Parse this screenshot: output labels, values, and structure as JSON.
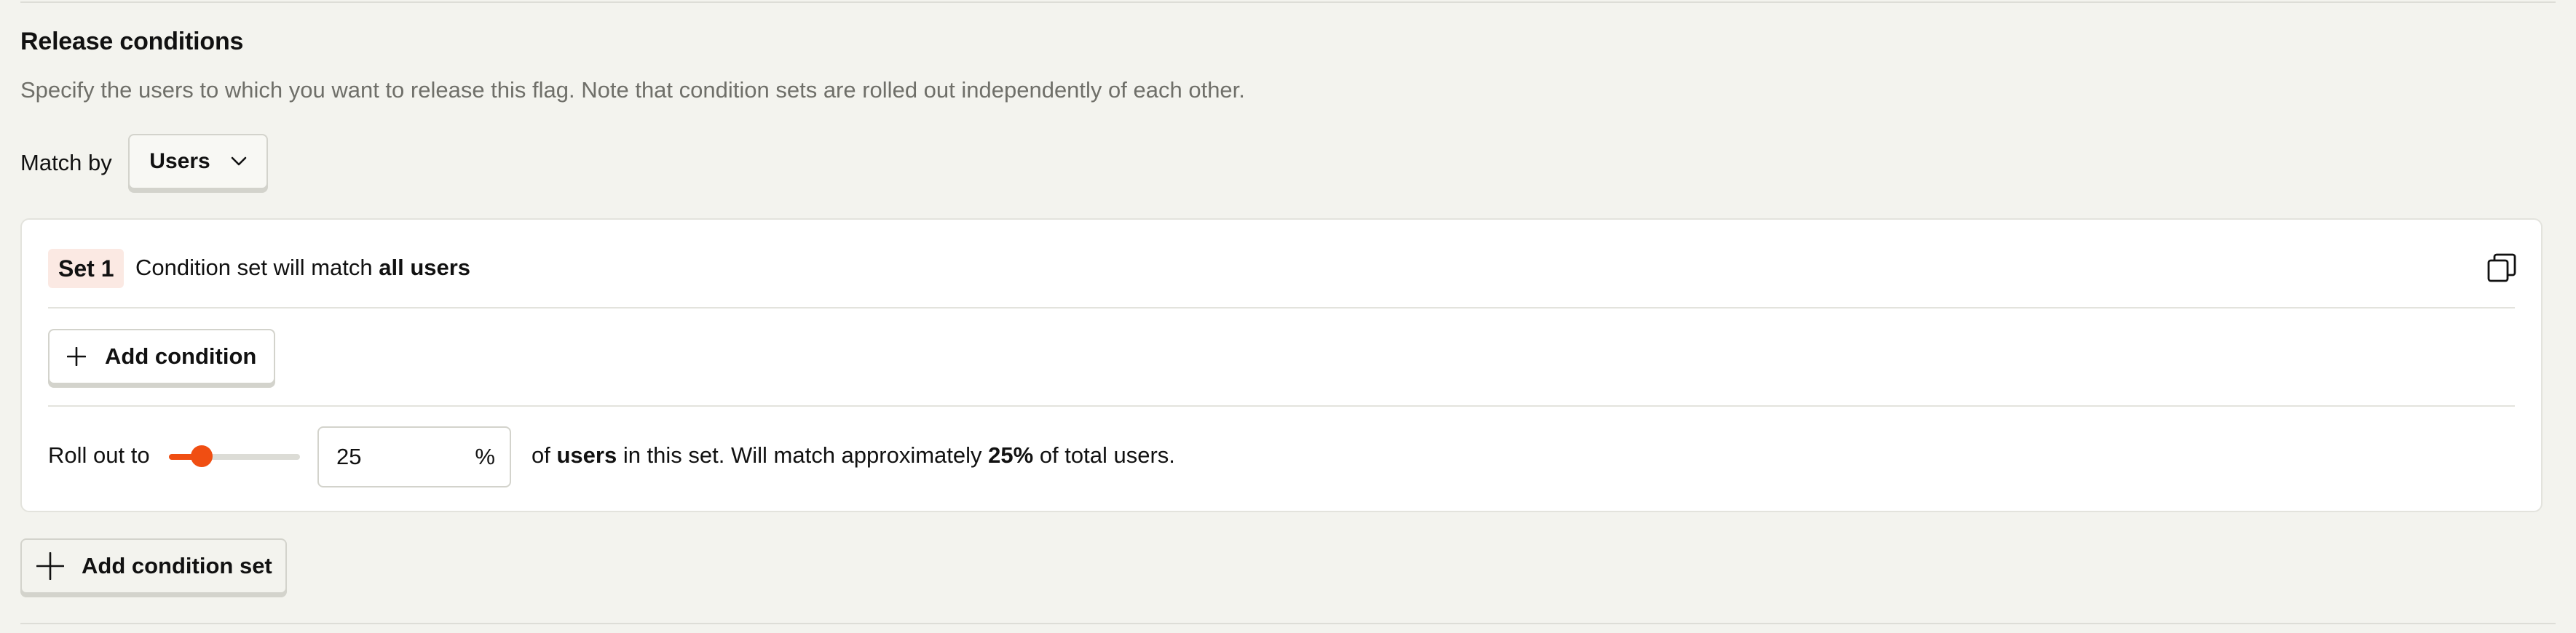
{
  "section": {
    "title": "Release conditions",
    "description": "Specify the users to which you want to release this flag. Note that condition sets are rolled out independently of each other."
  },
  "match": {
    "label": "Match by",
    "selected": "Users"
  },
  "condition_set": {
    "badge": "Set 1",
    "summary_prefix": "Condition set will match ",
    "summary_bold": "all users",
    "add_condition_label": "Add condition",
    "rollout": {
      "label": "Roll out to",
      "value": "25",
      "percent": 25,
      "suffix": "%",
      "text_1": "of ",
      "text_bold_1": "users",
      "text_2": " in this set. Will match approximately ",
      "text_bold_2": "25%",
      "text_3": " of total users."
    }
  },
  "add_condition_set_label": "Add condition set",
  "colors": {
    "accent": "#f04e12",
    "badge_bg": "#fbe9e3",
    "page_bg": "#f3f3ee"
  },
  "icons": {
    "dropdown": "chevron-down-icon",
    "copy": "copy-icon",
    "add": "plus-icon"
  }
}
